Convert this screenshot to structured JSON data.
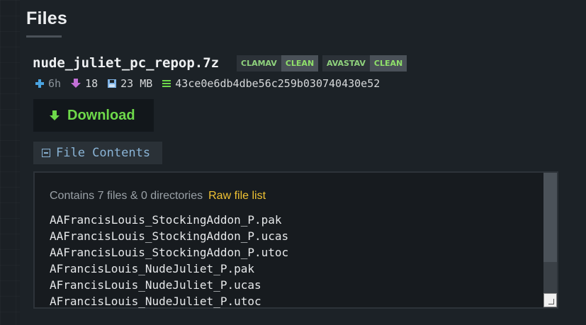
{
  "section": {
    "title": "Files"
  },
  "file": {
    "name": "nude_juliet_pc_repop.7z",
    "scans": [
      {
        "engine": "CLAMAV",
        "result": "CLEAN"
      },
      {
        "engine": "AVASTAV",
        "result": "CLEAN"
      }
    ],
    "meta": {
      "age": "6h",
      "downloads": "18",
      "size": "23 MB",
      "hash": "43ce0e6db4dbe56c259b030740430e52"
    }
  },
  "download": {
    "label": "Download"
  },
  "contents": {
    "toggle_label": "File Contents",
    "summary": "Contains 7 files & 0 directories",
    "raw_link": "Raw file list",
    "files": [
      "AAFrancisLouis_StockingAddon_P.pak",
      "AAFrancisLouis_StockingAddon_P.ucas",
      "AAFrancisLouis_StockingAddon_P.utoc",
      "AFrancisLouis_NudeJuliet_P.pak",
      "AFrancisLouis_NudeJuliet_P.ucas",
      "AFrancisLouis_NudeJuliet_P.utoc"
    ]
  },
  "colors": {
    "accent_green": "#6ed94a",
    "link_blue": "#8ab4d6",
    "link_yellow": "#f0c233",
    "upload_icon": "#4aa3e0",
    "download_icon": "#c26fd6",
    "size_icon": "#7fb3e6",
    "hash_icon": "#6ed94a"
  },
  "icons": {
    "age": "plus-icon",
    "downloads": "download-arrow-icon",
    "size": "floppy-disk-icon",
    "hash": "hash-lines-icon",
    "download_button": "download-arrow-icon",
    "toggle": "collapse-minus-icon"
  }
}
